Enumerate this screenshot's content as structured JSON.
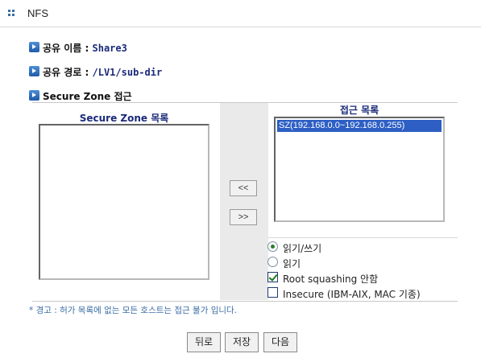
{
  "header": {
    "title": "NFS"
  },
  "share": {
    "name_label": "공유 이름 : ",
    "name_value": "Share3",
    "path_label": "공유 경로 : ",
    "path_value": "/LV1/sub-dir",
    "zone_label": "Secure Zone 접근"
  },
  "secure_zone_list": {
    "title": "Secure Zone 목록",
    "items": []
  },
  "access_list": {
    "title": "접근 목록",
    "items": [
      "SZ(192.168.0.0~192.168.0.255)"
    ]
  },
  "move_buttons": {
    "add_label": "<<",
    "remove_label": ">>"
  },
  "options": {
    "read_write": {
      "label": "읽기/쓰기",
      "selected": true
    },
    "read_only": {
      "label": "읽기",
      "selected": false
    },
    "root_squashing": {
      "label": "Root squashing 안함",
      "checked": true
    },
    "insecure": {
      "label": "Insecure (IBM-AIX, MAC 기종)",
      "checked": false
    }
  },
  "warning_text": "* 경고 : 허가 목록에 없는 모든 호스트는 접근 불가 입니다.",
  "footer": {
    "back_label": "뒤로",
    "save_label": "저장",
    "next_label": "다음"
  },
  "colors": {
    "accent": "#2d5fc4",
    "label_blue": "#1a2a7a",
    "warning": "#3a6ea5"
  }
}
